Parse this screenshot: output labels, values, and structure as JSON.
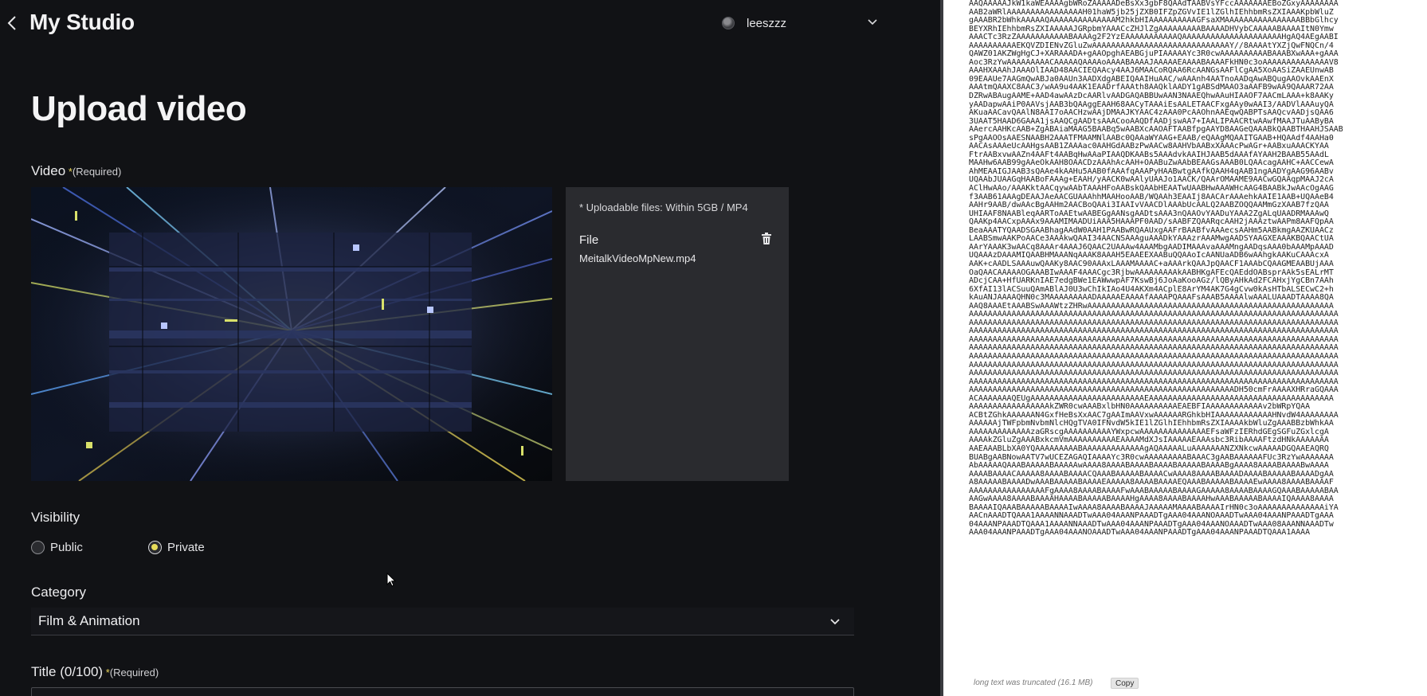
{
  "app": {
    "header": {
      "title": "My Studio",
      "username": "leeszzz"
    },
    "page_title": "Upload video",
    "video_field": {
      "label": "Video",
      "required_mark": "*",
      "required_text": "(Required)"
    },
    "upload_panel": {
      "note": "* Uploadable files: Within 5GB / MP4",
      "file_label": "File",
      "file_name": "MeitalkVideoMpNew.mp4"
    },
    "visibility": {
      "label": "Visibility",
      "options": [
        {
          "label": "Public",
          "selected": false
        },
        {
          "label": "Private",
          "selected": true
        }
      ]
    },
    "category": {
      "label": "Category",
      "value": "Film & Animation"
    },
    "title_field": {
      "label": "Title (0/100)",
      "required_mark": "*",
      "required_text": "(Required)"
    },
    "colors": {
      "accent_radio": "#e7dc5a",
      "panel_bg": "#2a2b2f",
      "page_bg": "#111215"
    }
  },
  "raw_pane": {
    "lines": [
      "AAQAAAAAJkW1kaWEAAAAgbWRoZAAAAADeBsXx3gbF8QAAdTAABVsYFccAAAAAAAEBoZGxyAAAAAAAA",
      "AAB2aWRlAAAAAAAAAAAAAAAAH01haW5jb25jZXB0IFZpZGVvIE1lZGlhIEhhbmRsZXIAAAKpbWluZ",
      "gAAABR2bWhkAAAAAQAAAAAAAAAAAAAAM2hkbHIAAAAAAAAAAGFsaXMAAAAAAAAAAAAAAAABBbGlhcy",
      "BEYXRhIEhhbmRsZXIAAAAAJGRpbmYAAACcZHJlZgAAAAAAAAABAAAADHVybCAAAAABAAAAItN0Ymw",
      "AAACTc3RzZAAAAAAAAAAABAAAAg2F2YzEAAAAAAAAAAAQAAAAAAAAAAAAAAAAAAAAAHgAQ4AEgAABI",
      "AAAAAAAAAAEKQVZDIENvZGluZwAAAAAAAAAAAAAAAAAAAAAAAAAAAAAY//8AAAAtYXZjQwFNQCn/4",
      "QAWZ01AKZWgHgCJ+XARAAADA+gAAOpghAEABGjuPIAAAAAYc3R0cwAAAAAAAAAABAAABXwAAA+gAAA",
      "Aoc3RzYwAAAAAAAAACAAAAAQAAAAoAAAABAAAAJAAAAAEAAAABAAAAFkHN0c3oAAAAAAAAAAAAAAV8",
      "AAAHXAAAhJAAAOlIAAD48AACIEQAAcy4AAJ6MAACoRQAA6RcAANGsAAFlCgAA5XoAASiZAAEUnwAB",
      "09EAAUe7AAGmQwABJa0AAUn3AADXdgABEIQAAIHuAAC/wAAAnh4AATnoAADqAwABQugAAOvkAAEnX",
      "AAAtmQAAXC8AAC3/wAA9u4AAK1EAADrfAAAth8AAQklAADY1gABSdMAAO3aAAFB9wAA9QAAAR72AA",
      "DZRwABAugAAME+AAD4awAAzDcAARlvAADGAQABBUwAAN3NAAEQhwAAuHIAAOF7AACmLAAA+k8AAKy",
      "yAADapwAAiP0AAVsjAAB3bQAAggEAAH68AACyTAAAiEsAALETAACFxgAAy0wAAI3/AADVlAAAuyQA",
      "AKuaAACavQAAlN8AAI7oAACHzwAAjDMAAJKYAAC4zAAA0PcAAOhnAAEqwQABPTsAAQcvAADjsQAA6",
      "3UAAT5HAAD6GAAA1jsAAQCgAADtsAAACooAAQDfAADjswAA7+IAALIPAACRtwAAwfMAAJTuAAByBA",
      "AAercAAHKcAAB+ZgABAiaMAAG5BAABq5wAABXcAAOAFTAABfpgAAYD8AAGeQAAABkQAABTHAAHJSAAB",
      "sPgAAOOsAAESNAABH2AAATFMAAMNlAABc0QAAaWYAAG+EAAB/eQAAgMQAAITGAAB+HQAAdf4AAHa0",
      "AACAsAAAeUcAAHgsAAB1ZAAAac0AAHGdAABzPwAACw8AAHVbAABxXAAAcPwAGr+AABxuAAACKYAA",
      "FtrAABxvwAAZn4AAFt4AABqHwAAaPIAAQDKAABs5AAAdvkAAIHJAAB5dAAAfAYAAH2BAAB55AAdL",
      "MAAHw6AAB99gAAeOkAAH8OAACDzAAAhAcAAH+OAABuZwAAbBEAAGsAAAB0LQAAcagAAHC+AACCewA",
      "AhMEAAIGJAAB3sQAAe4kAAHu5AAB0fAAAfqAAAPyHAABwtgAAfkQAAH4qAAB1ngAADYgAAG96AABv",
      "UQAAbJUAAGqHAABoFAAAg+EAAH/yAACK0wAAlyUAAJo1AACK/QAArOMAAME9AACwGQAAqpMAAJ2cA",
      "AClHwAAo/AAAKktAACqywAAbTAAAHFoAABskQAAbHEAATwUAABHwAAAWHcAAG4BAABkJwAAcOgAAG",
      "f3AAB61AAAgDEAAJAeAACGUAAAhhMAAHooAAB/WQAAh3EAAIj8AACArAAAehkAAIE1AAB+UQAAeB4",
      "AAHr9AAB/dwAAcBgAAHm2AACBoQAAi3IAAIvVAACDlAAAbUcAALQ2AABZOQQAAMmGzXAAB7fzQAA",
      "UHIAAF8NAABleqAARToAAEtwAABEGgAANsgAADtsAAA3nQAAOvYAADuYAAA2ZgALqUAADRMAAAwQ",
      "QAAKp4AACxpAAAx9AAAMIMAADUiAAA5HAAAPF0AAD/sAABFZQAARqcAAH2jAAAztwAAPm8AAFQpAA",
      "BeaAAATYQAADSGAABhagAAdW0AAH1PAABwRQAAUxgAAFrBAABfvAAAecsAAHm5AABkmgAAZKUAACz",
      "LAABSmwAAKPoAACe3AAAkwQAAI34AACNSAAAguAAADkYAAAzrAAAMwgAADSYAAGXEAAAKBQAACtUA",
      "AArYAAAK3wAACq8AAAr4AAAJ6QAAC2UAAAw4AAAMbgAADIMAAAvaAAAMngAADqsAAA0bAAAMpAAAD",
      "UQAAAzDAAAMIQAABHMAAANqAAAK8AAAH5EAAEEXAABuQQAAoIcAANUaADB6wAAhgkAAKuCAAAcxA",
      "AAK+cAADLSAAAuwQAAKy8AAC90AAAxLAAAMAAAAC+aAAArkQAAJpQAACF1AAAbCQAAGMEAABUjAAA",
      "OaQAACAAAAAOGAAABIwAAAF4AAACgc3RjbwAAAAAAAAAkAABHKgAFEcQAEddOABsprAAk5sEALrMT",
      "ADcjCAA+HfUARKnIAE7edgBWe1EAWwwpAF7KswBj6JoAaKooAGz/lQByAHkAd2FCAHxjYgCBn7AAh",
      "6XfAI13lACSuuQAmABlAJ0U3wChIkIAo4U4AKXm4ACplE8ArYM4AK7G4gCvw0kAsHTbALSECwC2+h",
      "kAuANJAAAAQHN0c3MAAAAAAAAADAAAAAEAAAAfAAAAPQAAAFsAAAB5AAAAlwAAALUAAADTAAAA8QA",
      "AAQ8AAAEtAAABSwAAAWtzZHRwAAAAAAAAAAAAAAAAAAAAAAAAAAAAAAAAAAAAAAAAAAAAAAAAAAAA",
      "AAAAAAAAAAAAAAAAAAAAAAAAAAAAAAAAAAAAAAAAAAAAAAAAAAAAAAAAAAAAAAAAAAAAAAAAAAAAAA",
      "AAAAAAAAAAAAAAAAAAAAAAAAAAAAAAAAAAAAAAAAAAAAAAAAAAAAAAAAAAAAAAAAAAAAAAAAAAAAAA",
      "AAAAAAAAAAAAAAAAAAAAAAAAAAAAAAAAAAAAAAAAAAAAAAAAAAAAAAAAAAAAAAAAAAAAAAAAAAAAAA",
      "AAAAAAAAAAAAAAAAAAAAAAAAAAAAAAAAAAAAAAAAAAAAAAAAAAAAAAAAAAAAAAAAAAAAAAAAAAAAAA",
      "AAAAAAAAAAAAAAAAAAAAAAAAAAAAAAAAAAAAAAAAAAAAAAAAAAAAAAAAAAAAAAAAAAAAAAAAAAAAAA",
      "AAAAAAAAAAAAAAAAAAAAAAAAAAAAAAAAAAAAAAAAAAAAAAAAAAAAAAAAAAAAAAAAAAAAAAAAAAAAAA",
      "AAAAAAAAAAAAAAAAAAAAAAAAAAAAAAAAAAAAAAAAAAAAAAAAAAAAAAAAAAAAAAAAAAAAAAAAAAAAAA",
      "AAAAAAAAAAAAAAAAAAAAAAAAAAAAAAAAAAAAAAAAAAAAAAAAAAAAAAAAAAAAAAAAAAAAAAAAAAAAAA",
      "AAAAAAAAAAAAAAAAAAAAAAAAAAAAAAAAAAAAAAAAAAAAAAAAAAAAAAAAAAAAAAAAAAAAAAAAAAAAAA",
      "AAAAAAAAAAAAAAAAAAAAAAAAAAAAAAAAAAAAAAAAAAAAAAAAAAAAAAAADH50cmFrAAAAXHRraGQAAA",
      "ACAAAAAAAQEUgAAAAAAAAAAAAAAAAAAAAAAAAEAAAAAAAAAAAAAAAAAAAAAAAAAAAAAAAAAAAAAAA",
      "AAAAAAAAAAAAAAAAAkZWR0cwAAABxlbHN0AAAAAAAAAAEAEBFIAAAAAAAAAAAAv2bWRpYQAA",
      "ACBtZGhkAAAAAAN4GxfHeBsXxAAC7gAAImAAVxwAAAAAARGhkbHIAAAAAAAAAAAAHNvdW4AAAAAAAA",
      "AAAAAAjTWFpbmNvbmNlcHQgTVA0IFNvdW5kIE1lZGlhIEhhbmRsZXIAAAAkbWluZgAAABBzbWhkAA",
      "AAAAAAAAAAAAAzaGRscgAAAAAAAAAAYWxpcwAAAAAAAAAAAAAAEFsaWFzIERhdGEgSGFuZGxlcgA",
      "AAAAkZGluZgAAABxkcmVmAAAAAAAAAAEAAAAMdXJsIAAAAAEAAAsbc3RibAAAAFtzdHNkAAAAAAA",
      "AAEAAABLbXA0YQAAAAAAAAABAAAAAAAAAAAAAgAQAAAAALuAAAAAAANZXNkcwAAAAADGQAAEAQRQ",
      "BUABgAABNowAATV7wUCEZAGAQIAAAAYc3R0cwAAAAAAAAABAAAC3gAABAAAAAAFUc3RzYwAAAAAAA",
      "AbAAAAAQAAABAAAAABAAAAAwAAAA8AAAABAAAABAAAABAAAAABAAAABgAAAA8AAAABAAAABwAAAA",
      "AAAABAAAACAAAAA8AAAABAAAACQAAABAAAAABAAAACwAAAA8AAAABAAAADAAAABAAAAABAAAADgAA",
      "A8AAAAABAAAADwAAABAAAAABAAAAEAAAAA8AAAABAAAAEQAAABAAAAABAAAAEwAAAA8AAAABAAAAF",
      "AAAAAAAAAAAAAAAAFgAAAA8AAAABAAAAFwAAABAAAAABAAAAGAAAAA8AAAABAAAAGQAAABAAAAABAA",
      "AAGwAAAA8AAAABAAAAHAAAABAAAAABAAAAHgAAAA8AAAABAAAAHwAAABAAAAABAAAAIQAAAA8AAAA",
      "BAAAAIQAAABAAAAABAAAAIwAAAA8AAAABAAAAJAAAAAMAAAABAAAAIrHN0c3oAAAAAAAAAAAAAAiYA",
      "AACnAAADTQAAA1AAAANNAAADTwAAA04AAANPAAADTgAAA04AAANOAAADTwAAA04AAANPAAADTgAAA",
      "04AAANPAAADTQAAA1AAAANNAAADTwAAA04AAANPAAADTgAAA04AAANOAAADTwAAA08AAANNAAADTw",
      "AAA04AAANPAAADTgAAA04AAANOAAADTwAAA04AAANPAAADTgAAA04AAANPAAADTQAAA1AAAA"
    ],
    "truncate_note": "long text was truncated (16.1 MB)",
    "copy_label": "Copy"
  }
}
